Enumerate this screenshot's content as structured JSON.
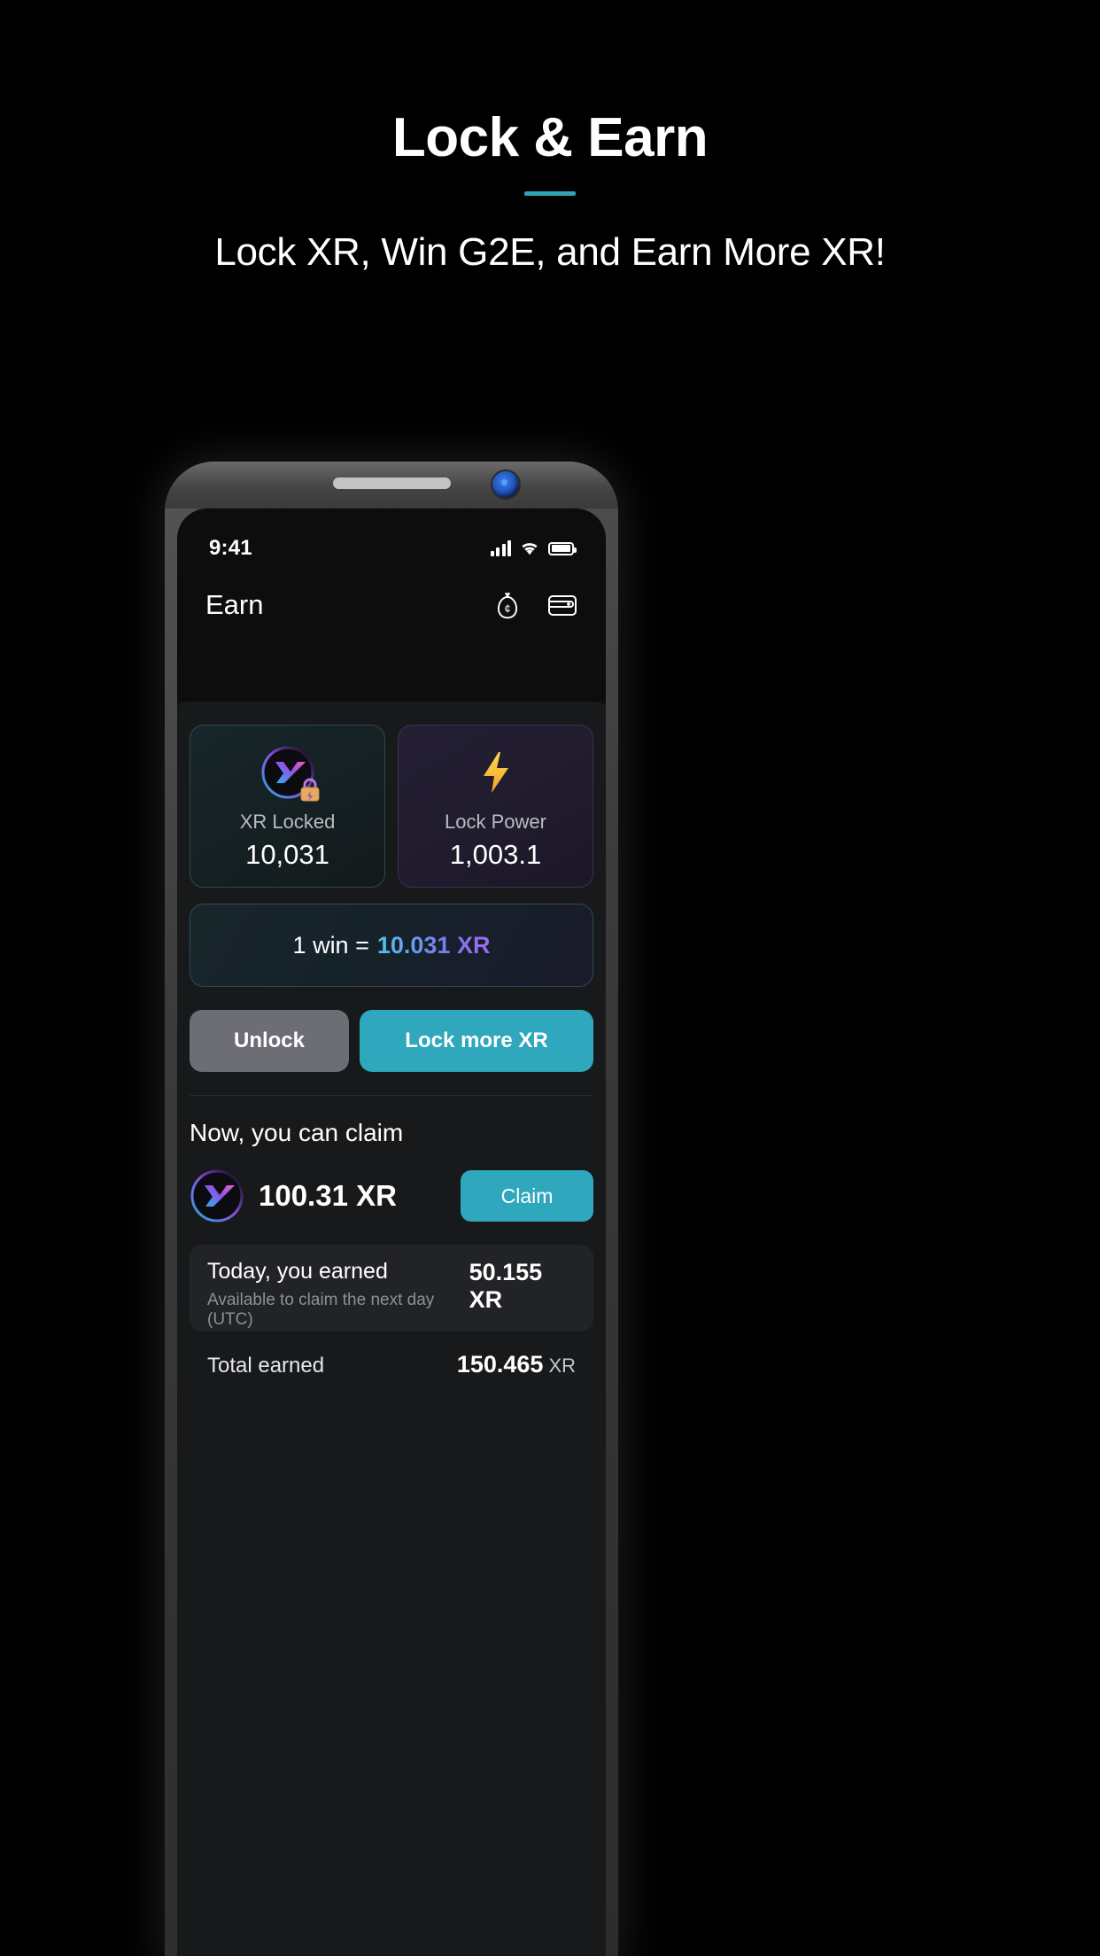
{
  "promo": {
    "title": "Lock & Earn",
    "subtitle": "Lock XR, Win G2E, and Earn More XR!",
    "accent_color": "#2fa3b5"
  },
  "phone": {
    "status_bar": {
      "time": "9:41",
      "signal_icon": "cellular-bars-icon",
      "wifi_icon": "wifi-icon",
      "battery_icon": "battery-icon"
    },
    "app_header": {
      "title": "Earn",
      "icons": [
        {
          "name": "money-bag-icon"
        },
        {
          "name": "wallet-icon"
        }
      ]
    },
    "stats": [
      {
        "icon": "xr-token-locked-icon",
        "label": "XR Locked",
        "value": "10,031"
      },
      {
        "icon": "lightning-bolt-icon",
        "label": "Lock Power",
        "value": "1,003.1"
      }
    ],
    "win_rate": {
      "prefix": "1 win =",
      "amount": "10.031 XR"
    },
    "actions": {
      "unlock_label": "Unlock",
      "lock_more_label": "Lock more XR",
      "unlock_color": "#6d6e75",
      "lock_more_color": "#2fa7bd"
    },
    "claim_section": {
      "heading": "Now, you can claim",
      "token_icon": "xr-token-icon",
      "amount": "100.31 XR",
      "claim_label": "Claim"
    },
    "today_earned": {
      "title": "Today, you earned",
      "subtitle": "Available to claim the next day (UTC)",
      "amount": "50.155 XR"
    },
    "total_earned": {
      "label": "Total earned",
      "value": "150.465",
      "unit": "XR"
    }
  }
}
